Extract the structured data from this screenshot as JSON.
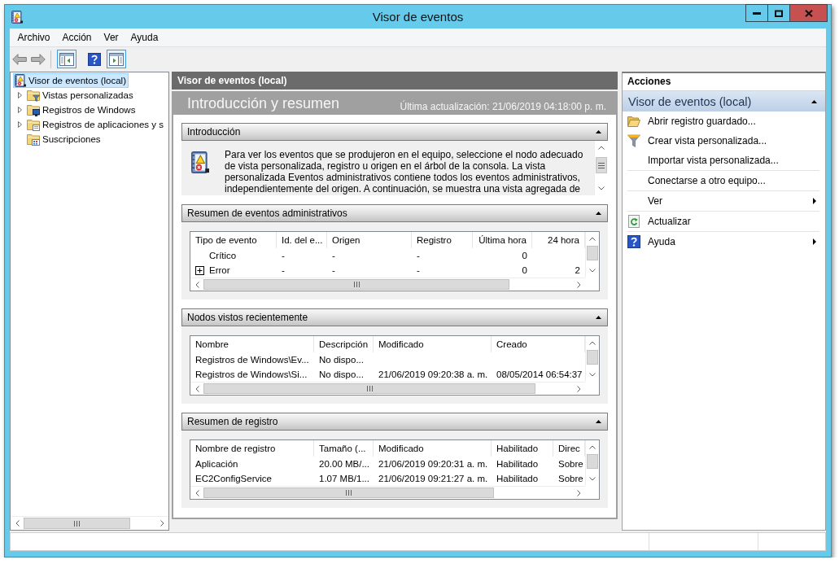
{
  "window": {
    "title": "Visor de eventos"
  },
  "menu": [
    "Archivo",
    "Acción",
    "Ver",
    "Ayuda"
  ],
  "toolbar": {
    "navigation": [
      {
        "kind": "back",
        "disabled": true
      },
      {
        "kind": "forward",
        "disabled": true
      }
    ],
    "buttons": [
      {
        "kind": "console-tree",
        "pressed": true
      },
      {
        "kind": "help",
        "pressed": false
      },
      {
        "kind": "action-pane",
        "pressed": true
      }
    ]
  },
  "console_tree": {
    "items": [
      {
        "label": "Visor de eventos (local)",
        "selected": true,
        "children": [
          {
            "label": "Vistas personalizadas",
            "selected": false,
            "expandable": true,
            "expanded": false
          },
          {
            "label": "Registros de Windows",
            "selected": false,
            "expandable": true,
            "expanded": false
          },
          {
            "label": "Registros de aplicaciones y s",
            "selected": false,
            "expandable": true,
            "expanded": false
          },
          {
            "label": "Suscripciones",
            "selected": false,
            "expandable": false,
            "expanded": false
          }
        ]
      }
    ]
  },
  "center": {
    "header": "Visor de eventos (local)",
    "title": "Introducción y resumen",
    "last_updated": "Última actualización: 21/06/2019 04:18:00 p. m.",
    "sections": [
      {
        "kind": "text",
        "title": "Introducción",
        "expanded": true,
        "text": "Para ver los eventos que se produjeron en el equipo, seleccione el nodo adecuado de vista personalizada, registro u origen en el árbol de la consola. La vista personalizada Eventos administrativos contiene todos los eventos administrativos, independientemente del origen. A continuación, se muestra una vista agregada de"
      },
      {
        "kind": "table",
        "title": "Resumen de eventos administrativos",
        "expanded": true,
        "columns": [
          {
            "label": "Tipo de evento",
            "kind": "text"
          },
          {
            "label": "Id. del e...",
            "kind": "text"
          },
          {
            "label": "Origen",
            "kind": "text"
          },
          {
            "label": "Registro",
            "kind": "text"
          },
          {
            "label": "Última hora",
            "kind": "number"
          },
          {
            "label": "24 hora",
            "kind": "number"
          }
        ],
        "rows": [
          {
            "cells": [
              "Crítico",
              "-",
              "-",
              "-",
              "0"
            ],
            "expandable": false
          },
          {
            "cells": [
              "Error",
              "-",
              "-",
              "-",
              "0",
              "2"
            ],
            "expandable": true
          }
        ]
      },
      {
        "kind": "table",
        "title": "Nodos vistos recientemente",
        "expanded": true,
        "columns": [
          {
            "label": "Nombre",
            "kind": "text"
          },
          {
            "label": "Descripción",
            "kind": "text"
          },
          {
            "label": "Modificado",
            "kind": "text"
          },
          {
            "label": "Creado",
            "kind": "text"
          }
        ],
        "rows": [
          {
            "cells": [
              "Registros de Windows\\Ev...",
              "No dispo..."
            ]
          },
          {
            "cells": [
              "Registros de Windows\\Si...",
              "No dispo...",
              "21/06/2019 09:20:38 a. m.",
              "08/05/2014 06:54:37"
            ]
          }
        ]
      },
      {
        "kind": "table",
        "title": "Resumen de registro",
        "expanded": true,
        "columns": [
          {
            "label": "Nombre de registro",
            "kind": "text"
          },
          {
            "label": "Tamaño (...",
            "kind": "text"
          },
          {
            "label": "Modificado",
            "kind": "text"
          },
          {
            "label": "Habilitado",
            "kind": "text"
          },
          {
            "label": "Direc",
            "kind": "text"
          }
        ],
        "rows": [
          {
            "cells": [
              "Aplicación",
              "20.00 MB/...",
              "21/06/2019 09:20:31 a. m.",
              "Habilitado",
              "Sobre"
            ]
          },
          {
            "cells": [
              "EC2ConfigService",
              "1.07 MB/1...",
              "21/06/2019 09:21:27 a. m.",
              "Habilitado",
              "Sobre"
            ]
          }
        ]
      }
    ]
  },
  "actions": {
    "title": "Acciones",
    "group_title": "Visor de eventos (local)",
    "expanded": true,
    "groups": [
      {
        "items": [
          {
            "label": "Abrir registro guardado...",
            "submenu": false
          },
          {
            "label": "Crear vista personalizada...",
            "submenu": false
          },
          {
            "label": "Importar vista personalizada...",
            "submenu": false
          }
        ]
      },
      {
        "items": [
          {
            "label": "Conectarse a otro equipo...",
            "submenu": false
          }
        ]
      },
      {
        "items": [
          {
            "label": "Ver",
            "submenu": true
          }
        ]
      },
      {
        "items": [
          {
            "label": "Actualizar",
            "submenu": false
          }
        ]
      },
      {
        "items": [
          {
            "label": "Ayuda",
            "submenu": true
          }
        ]
      }
    ]
  }
}
